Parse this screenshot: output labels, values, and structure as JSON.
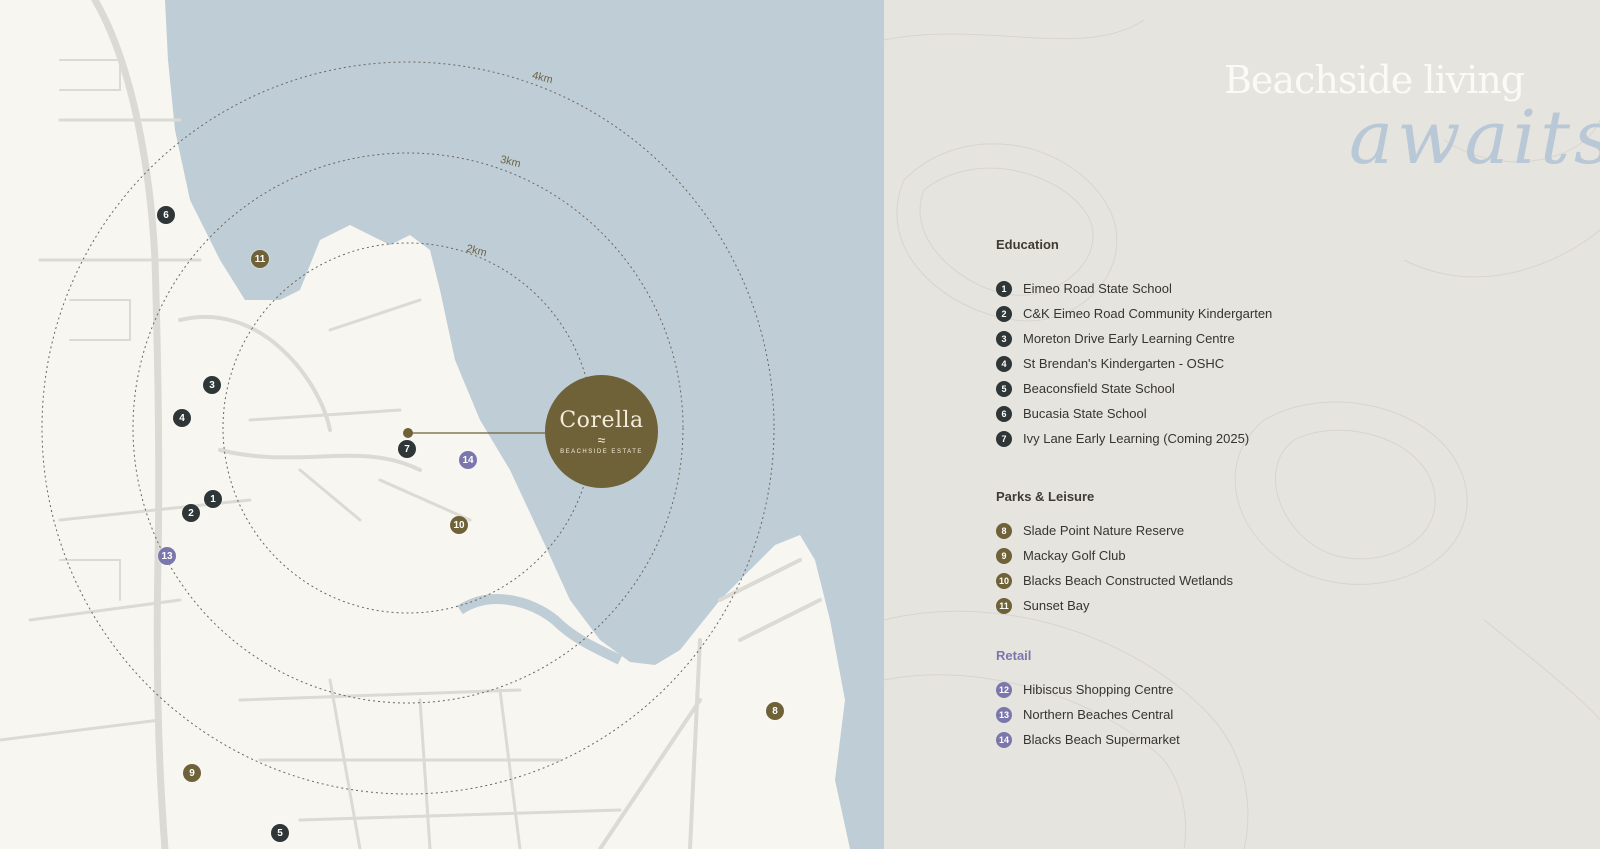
{
  "map": {
    "ring_labels": [
      "2km",
      "3km",
      "4km"
    ],
    "logo": {
      "name": "Corella",
      "wave": "≈",
      "tagline": "BEACHSIDE ESTATE"
    },
    "markers": {
      "m1": "1",
      "m2": "2",
      "m3": "3",
      "m4": "4",
      "m5": "5",
      "m6": "6",
      "m7": "7",
      "m8": "8",
      "m9": "9",
      "m10": "10",
      "m11": "11",
      "m13": "13",
      "m14": "14"
    }
  },
  "panel": {
    "headline": "Beachside living",
    "script": "awaits",
    "education": {
      "title": "Education",
      "items": [
        {
          "num": "1",
          "label": "Eimeo Road State School"
        },
        {
          "num": "2",
          "label": "C&K Eimeo Road Community Kindergarten"
        },
        {
          "num": "3",
          "label": "Moreton Drive Early Learning Centre"
        },
        {
          "num": "4",
          "label": "St Brendan's Kindergarten - OSHC"
        },
        {
          "num": "5",
          "label": "Beaconsfield State School"
        },
        {
          "num": "6",
          "label": "Bucasia State School"
        },
        {
          "num": "7",
          "label": "Ivy Lane Early Learning (Coming 2025)"
        }
      ]
    },
    "parks": {
      "title": "Parks & Leisure",
      "items": [
        {
          "num": "8",
          "label": "Slade Point Nature Reserve"
        },
        {
          "num": "9",
          "label": "Mackay Golf Club"
        },
        {
          "num": "10",
          "label": "Blacks Beach Constructed Wetlands"
        },
        {
          "num": "11",
          "label": "Sunset Bay"
        }
      ]
    },
    "retail": {
      "title": "Retail",
      "items": [
        {
          "num": "12",
          "label": "Hibiscus Shopping Centre"
        },
        {
          "num": "13",
          "label": "Northern Beaches Central"
        },
        {
          "num": "14",
          "label": "Blacks Beach Supermarket"
        }
      ]
    }
  },
  "colors": {
    "water": "#bfcdd6",
    "land": "#f8f6f1",
    "education": "#2f3637",
    "parks": "#6f6238",
    "retail": "#7b77ad"
  }
}
